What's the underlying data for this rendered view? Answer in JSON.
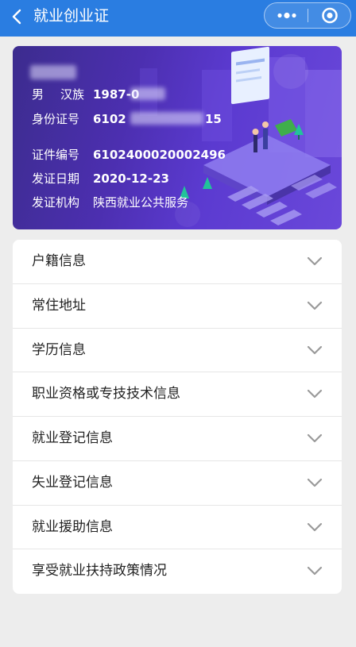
{
  "nav": {
    "title": "就业创业证"
  },
  "card": {
    "gender": "男",
    "ethnicity": "汉族",
    "birth": "1987-0",
    "id_label": "身份证号",
    "id_prefix": "6102",
    "id_suffix": "15",
    "cert_no_label": "证件编号",
    "cert_no": "6102400020002496",
    "issue_date_label": "发证日期",
    "issue_date": "2020-12-23",
    "issuer_label": "发证机构",
    "issuer": "陕西就业公共服务"
  },
  "sections": [
    {
      "label": "户籍信息"
    },
    {
      "label": "常住地址"
    },
    {
      "label": "学历信息"
    },
    {
      "label": "职业资格或专技技术信息"
    },
    {
      "label": "就业登记信息"
    },
    {
      "label": "失业登记信息"
    },
    {
      "label": "就业援助信息"
    },
    {
      "label": "享受就业扶持政策情况"
    }
  ]
}
